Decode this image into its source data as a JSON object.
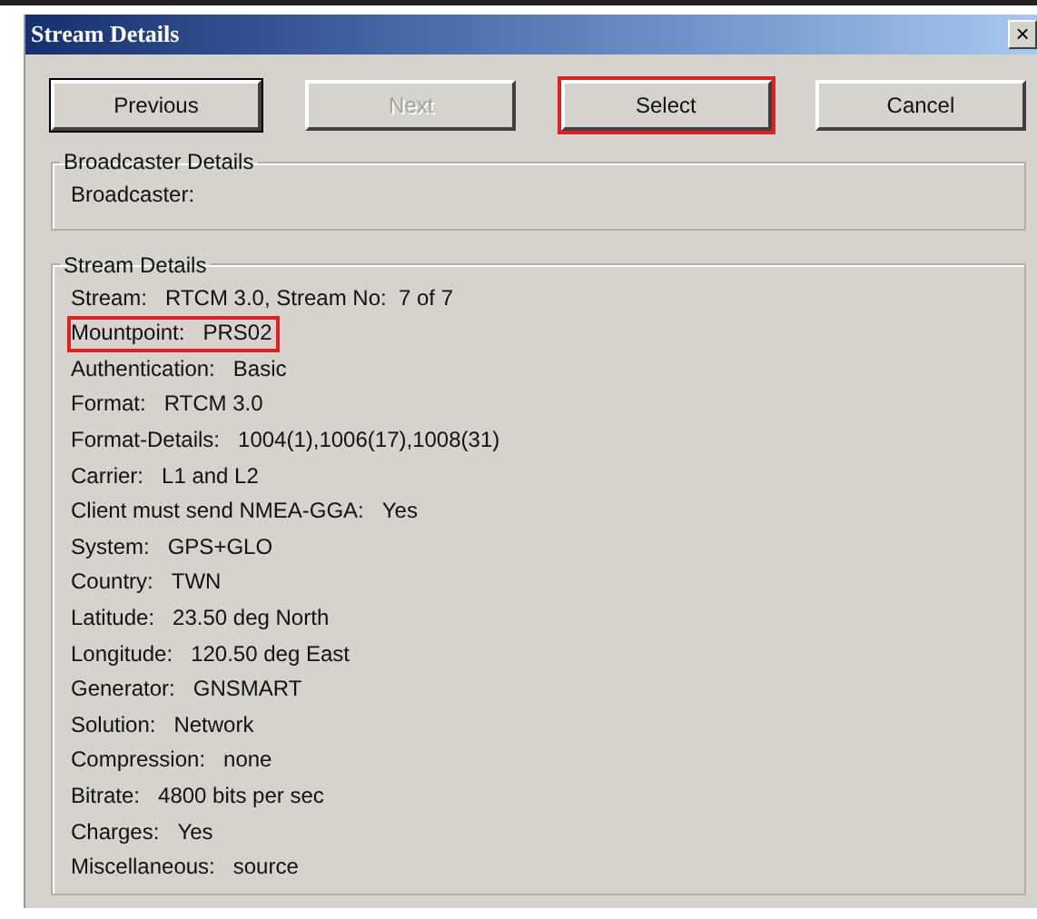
{
  "window": {
    "title": "Stream Details",
    "close": "×"
  },
  "buttons": [
    {
      "label": "Previous",
      "default": true,
      "disabled": false,
      "highlighted": false
    },
    {
      "label": "Next",
      "default": false,
      "disabled": true,
      "highlighted": false
    },
    {
      "label": "Select",
      "default": false,
      "disabled": false,
      "highlighted": true
    },
    {
      "label": "Cancel",
      "default": false,
      "disabled": false,
      "highlighted": false
    }
  ],
  "broadcaster_details": {
    "title": "Broadcaster Details",
    "lines": [
      {
        "label": "Broadcaster:",
        "highlighted": false
      }
    ]
  },
  "stream_details": {
    "title": "Stream Details",
    "lines": [
      {
        "label": "Stream:",
        "value": "RTCM 3.0, Stream No:  7 of 7",
        "highlighted": false
      },
      {
        "label": "Mountpoint:",
        "value": "PRS02",
        "highlighted": true
      },
      {
        "label": "Authentication:",
        "value": "Basic",
        "highlighted": false
      },
      {
        "label": "Format:",
        "value": "RTCM 3.0",
        "highlighted": false
      },
      {
        "label": "Format-Details:",
        "value": "1004(1),1006(17),1008(31)",
        "highlighted": false
      },
      {
        "label": "Carrier:",
        "value": "L1 and L2",
        "highlighted": false
      },
      {
        "label": "Client must send NMEA-GGA:",
        "value": "Yes",
        "highlighted": false
      },
      {
        "label": "System:",
        "value": "GPS+GLO",
        "highlighted": false
      },
      {
        "label": "Country:",
        "value": "TWN",
        "highlighted": false
      },
      {
        "label": "Latitude:",
        "value": "23.50 deg North",
        "highlighted": false
      },
      {
        "label": "Longitude:",
        "value": "120.50 deg East",
        "highlighted": false
      },
      {
        "label": "Generator:",
        "value": "GNSMART",
        "highlighted": false
      },
      {
        "label": "Solution:",
        "value": "Network",
        "highlighted": false
      },
      {
        "label": "Compression:",
        "value": "none",
        "highlighted": false
      },
      {
        "label": "Bitrate:",
        "value": "4800 bits per sec",
        "highlighted": false
      },
      {
        "label": "Charges:",
        "value": "Yes",
        "highlighted": false
      },
      {
        "label": "Miscellaneous:",
        "value": "source",
        "highlighted": false
      }
    ]
  }
}
